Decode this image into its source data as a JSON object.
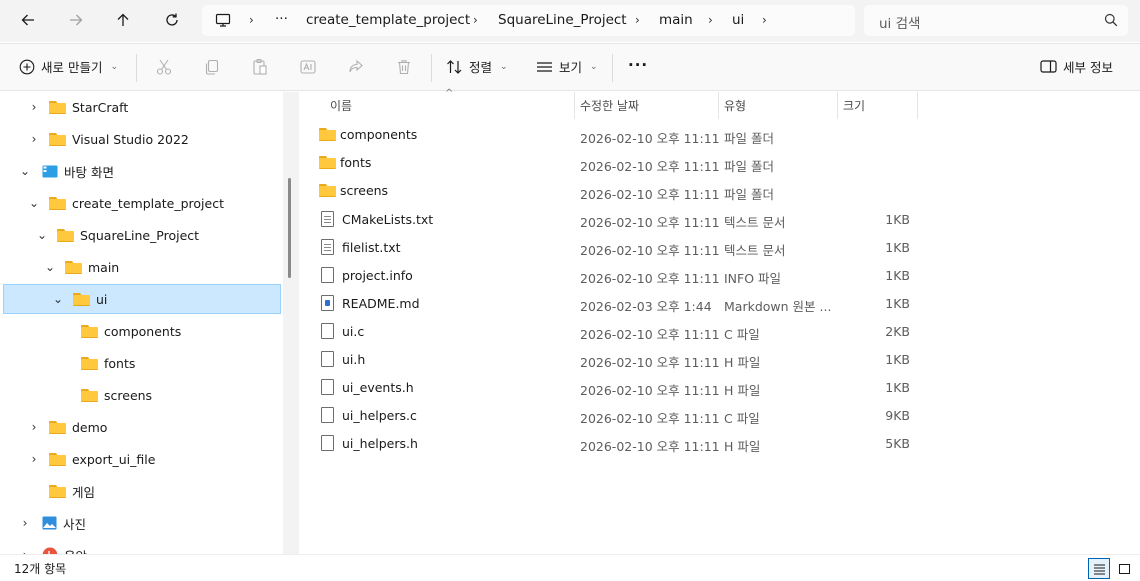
{
  "address": {
    "crumbs": [
      "create_template_project",
      "SquareLine_Project",
      "main",
      "ui"
    ],
    "overflow": "···"
  },
  "search": {
    "placeholder": "ui 검색"
  },
  "toolbar": {
    "new_label": "새로 만들기",
    "sort_label": "정렬",
    "view_label": "보기",
    "more_label": "···",
    "details_label": "세부 정보"
  },
  "nav": {
    "items": [
      {
        "label": "StarCraft",
        "icon": "folder"
      },
      {
        "label": "Visual Studio 2022",
        "icon": "folder"
      },
      {
        "label": "바탕 화면",
        "icon": "desktop"
      },
      {
        "label": "create_template_project",
        "icon": "folder"
      },
      {
        "label": "SquareLine_Project",
        "icon": "folder"
      },
      {
        "label": "main",
        "icon": "folder"
      },
      {
        "label": "ui",
        "icon": "folder"
      },
      {
        "label": "components",
        "icon": "folder"
      },
      {
        "label": "fonts",
        "icon": "folder"
      },
      {
        "label": "screens",
        "icon": "folder"
      },
      {
        "label": "demo",
        "icon": "folder"
      },
      {
        "label": "export_ui_file",
        "icon": "folder"
      },
      {
        "label": "게임",
        "icon": "folder"
      },
      {
        "label": "사진",
        "icon": "pictures"
      },
      {
        "label": "음악",
        "icon": "music"
      }
    ]
  },
  "columns": {
    "name": "이름",
    "date": "수정한 날짜",
    "type": "유형",
    "size": "크기"
  },
  "files": [
    {
      "name": "components",
      "date": "2026-02-10 오후 11:11",
      "type": "파일 폴더",
      "size": "",
      "icon": "folder"
    },
    {
      "name": "fonts",
      "date": "2026-02-10 오후 11:11",
      "type": "파일 폴더",
      "size": "",
      "icon": "folder"
    },
    {
      "name": "screens",
      "date": "2026-02-10 오후 11:11",
      "type": "파일 폴더",
      "size": "",
      "icon": "folder"
    },
    {
      "name": "CMakeLists.txt",
      "date": "2026-02-10 오후 11:11",
      "type": "텍스트 문서",
      "size": "1KB",
      "icon": "text-file"
    },
    {
      "name": "filelist.txt",
      "date": "2026-02-10 오후 11:11",
      "type": "텍스트 문서",
      "size": "1KB",
      "icon": "text-file"
    },
    {
      "name": "project.info",
      "date": "2026-02-10 오후 11:11",
      "type": "INFO 파일",
      "size": "1KB",
      "icon": "file"
    },
    {
      "name": "README.md",
      "date": "2026-02-03 오후 1:44",
      "type": "Markdown 원본 ...",
      "size": "1KB",
      "icon": "markdown-file"
    },
    {
      "name": "ui.c",
      "date": "2026-02-10 오후 11:11",
      "type": "C 파일",
      "size": "2KB",
      "icon": "file"
    },
    {
      "name": "ui.h",
      "date": "2026-02-10 오후 11:11",
      "type": "H 파일",
      "size": "1KB",
      "icon": "file"
    },
    {
      "name": "ui_events.h",
      "date": "2026-02-10 오후 11:11",
      "type": "H 파일",
      "size": "1KB",
      "icon": "file"
    },
    {
      "name": "ui_helpers.c",
      "date": "2026-02-10 오후 11:11",
      "type": "C 파일",
      "size": "9KB",
      "icon": "file"
    },
    {
      "name": "ui_helpers.h",
      "date": "2026-02-10 오후 11:11",
      "type": "H 파일",
      "size": "5KB",
      "icon": "file"
    }
  ],
  "status": {
    "count": "12개 항목"
  },
  "colors": {
    "selection": "#cce8ff",
    "selection_border": "#99d1ff",
    "folder": "#ffc83d",
    "accent": "#0063b1"
  }
}
